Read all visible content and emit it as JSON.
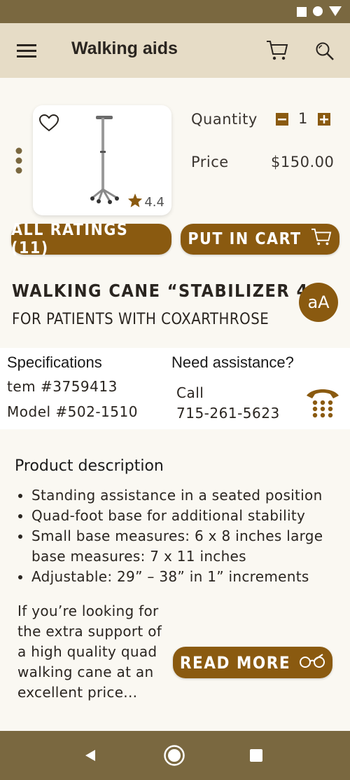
{
  "app": {
    "title": "Walking aids"
  },
  "colors": {
    "accent": "#8a5a10",
    "appbar": "#e6dcc6",
    "system_bar": "#7a6840"
  },
  "icons": {
    "menu": "hamburger-menu-icon",
    "cart": "shopping-cart-icon",
    "search": "magnifier-icon",
    "favorite": "heart-outline-icon",
    "star": "star-icon",
    "more": "vertical-dots-icon",
    "phone": "telephone-icon",
    "glasses": "reading-glasses-icon"
  },
  "product": {
    "rating": "4.4",
    "quantity_label": "Quantity",
    "quantity_value": "1",
    "price_label": "Price",
    "price_value": "$150.00",
    "all_ratings_label": "ALL RATINGS (11)",
    "put_in_cart_label": "PUT IN CART",
    "name": "WALKING CANE “STABILIZER 4”",
    "subtitle": "FOR PATIENTS WITH COXARTHROSE",
    "text_size_label": "aA"
  },
  "specs": {
    "heading": "Specifications",
    "item": "tem #3759413",
    "model": "Model #502-1510"
  },
  "assistance": {
    "heading": "Need assistance?",
    "call_label": "Call",
    "phone": "715-261-5623"
  },
  "description": {
    "heading": "Product description",
    "bullets": [
      "Standing assistance in a seated position",
      "Quad-foot base for additional stability",
      "Small base measures: 6 x 8 inches large base measures: 7 x 11 inches",
      "Adjustable: 29” – 38” in 1” increments"
    ],
    "paragraph": "If you’re looking for the extra support of a high quality quad walking cane at an excellent price...",
    "read_more_label": "READ MORE"
  }
}
